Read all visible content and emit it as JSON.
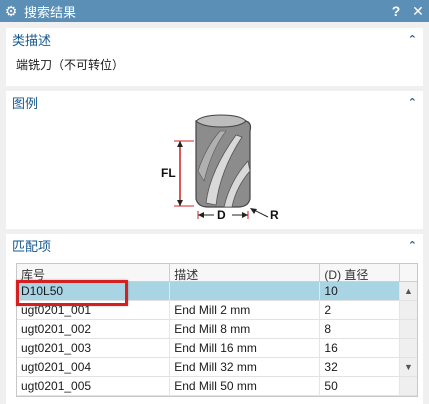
{
  "window": {
    "title": "搜索结果",
    "help_label": "?",
    "close_label": "✕",
    "settings_icon": "gear-icon"
  },
  "type_section": {
    "header": "类描述",
    "value": "端铣刀（不可转位）"
  },
  "legend_section": {
    "header": "图例",
    "labels": {
      "fl": "FL",
      "d": "D",
      "r": "R"
    }
  },
  "match_section": {
    "header": "匹配项",
    "columns": [
      "库号",
      "描述",
      "(D) 直径"
    ],
    "rows": [
      {
        "id": "D10L50",
        "desc": "",
        "dia": "10",
        "selected": true
      },
      {
        "id": "ugt0201_001",
        "desc": "End Mill 2 mm",
        "dia": "2"
      },
      {
        "id": "ugt0201_002",
        "desc": "End Mill 8 mm",
        "dia": "8"
      },
      {
        "id": "ugt0201_003",
        "desc": "End Mill 16 mm",
        "dia": "16"
      },
      {
        "id": "ugt0201_004",
        "desc": "End Mill 32 mm",
        "dia": "32"
      },
      {
        "id": "ugt0201_005",
        "desc": "End Mill 50 mm",
        "dia": "50"
      }
    ]
  },
  "colors": {
    "titlebar": "#5b8fb6",
    "header_text": "#17588f",
    "selected_row": "#a8d4e4",
    "highlight": "#d42020"
  }
}
